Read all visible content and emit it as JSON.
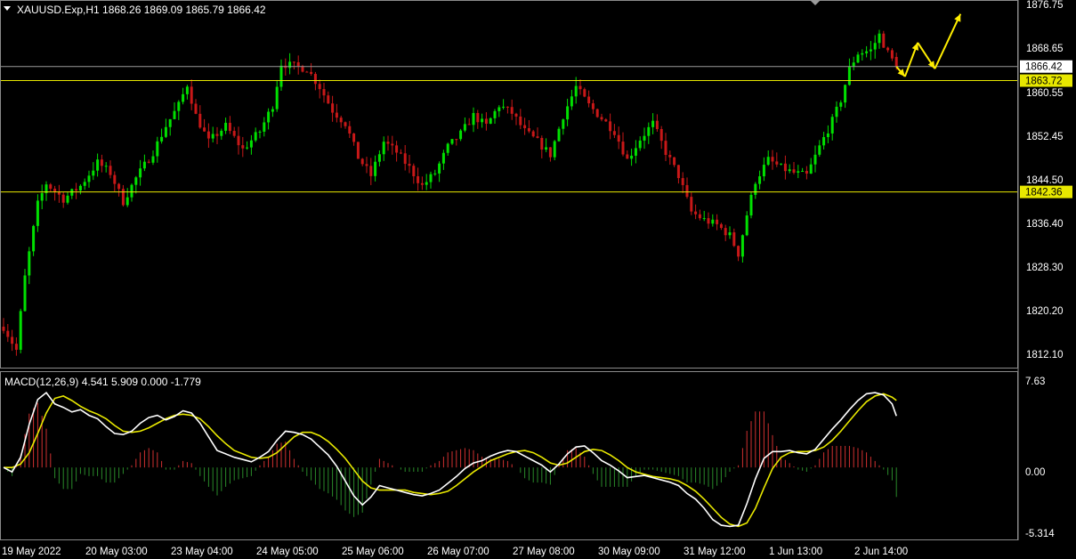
{
  "header": {
    "symbol_line": "XAUUSD.Exp,H1  1868.26 1869.09 1865.79 1866.42"
  },
  "colors": {
    "background": "#000000",
    "bull": "#00e000",
    "bear": "#c81818",
    "level_line": "#e8e800",
    "bid_line": "#9a9a9a",
    "macd_line": "#ffffff",
    "signal_line": "#e8e800",
    "hist_pos": "#d03030",
    "hist_neg": "#2a8a2a",
    "arrow": "#ffee00"
  },
  "price_axis": {
    "ticks": [
      "1876.75",
      "1868.65",
      "1860.55",
      "1852.45",
      "1844.50",
      "1836.40",
      "1828.30",
      "1820.20",
      "1812.10"
    ],
    "current_price": "1866.42",
    "level_upper": "1863.72",
    "level_lower": "1842.36"
  },
  "macd_panel": {
    "title": "MACD(12,26,9) 4.541 5.909 0.000 -1.779",
    "ticks": [
      "7.63",
      "0.00",
      "-5.314"
    ]
  },
  "time_axis": {
    "labels": [
      "19 May 2022",
      "20 May 03:00",
      "23 May 04:00",
      "24 May 05:00",
      "25 May 06:00",
      "26 May 07:00",
      "27 May 08:00",
      "30 May 09:00",
      "31 May 12:00",
      "1 Jun 13:00",
      "2 Jun 14:00"
    ]
  },
  "chart_data": {
    "type": "candlestick",
    "symbol": "XAUUSD.Exp",
    "timeframe": "H1",
    "last_bar": {
      "open": 1868.26,
      "high": 1869.09,
      "low": 1865.79,
      "close": 1866.42
    },
    "ylim": [
      1809.5,
      1878.5
    ],
    "close_path": [
      [
        0,
        1816.5
      ],
      [
        3,
        1812.0
      ],
      [
        5,
        1826.0
      ],
      [
        8,
        1840.0
      ],
      [
        10,
        1844.0
      ],
      [
        14,
        1841.0
      ],
      [
        18,
        1843.5
      ],
      [
        22,
        1848.0
      ],
      [
        25,
        1846.0
      ],
      [
        28,
        1840.5
      ],
      [
        31,
        1845.0
      ],
      [
        35,
        1850.0
      ],
      [
        38,
        1855.0
      ],
      [
        41,
        1859.0
      ],
      [
        43,
        1863.0
      ],
      [
        45,
        1857.0
      ],
      [
        48,
        1852.0
      ],
      [
        52,
        1855.0
      ],
      [
        56,
        1850.5
      ],
      [
        60,
        1854.0
      ],
      [
        63,
        1859.0
      ],
      [
        65,
        1867.0
      ],
      [
        68,
        1866.5
      ],
      [
        71,
        1866.0
      ],
      [
        74,
        1862.5
      ],
      [
        77,
        1858.0
      ],
      [
        80,
        1855.5
      ],
      [
        83,
        1849.0
      ],
      [
        86,
        1845.5
      ],
      [
        89,
        1852.0
      ],
      [
        92,
        1850.0
      ],
      [
        95,
        1847.0
      ],
      [
        98,
        1843.5
      ],
      [
        101,
        1846.0
      ],
      [
        104,
        1851.0
      ],
      [
        107,
        1853.5
      ],
      [
        110,
        1857.0
      ],
      [
        113,
        1855.0
      ],
      [
        116,
        1859.0
      ],
      [
        119,
        1857.5
      ],
      [
        122,
        1854.0
      ],
      [
        125,
        1852.0
      ],
      [
        128,
        1849.5
      ],
      [
        131,
        1857.0
      ],
      [
        134,
        1862.5
      ],
      [
        137,
        1859.0
      ],
      [
        140,
        1856.5
      ],
      [
        143,
        1854.0
      ],
      [
        146,
        1848.5
      ],
      [
        149,
        1852.5
      ],
      [
        152,
        1855.5
      ],
      [
        155,
        1850.0
      ],
      [
        158,
        1845.5
      ],
      [
        161,
        1838.5
      ],
      [
        164,
        1837.0
      ],
      [
        167,
        1836.0
      ],
      [
        170,
        1834.0
      ],
      [
        172,
        1830.5
      ],
      [
        174,
        1838.0
      ],
      [
        176,
        1844.5
      ],
      [
        179,
        1848.5
      ],
      [
        182,
        1847.0
      ],
      [
        185,
        1846.0
      ],
      [
        188,
        1845.5
      ],
      [
        191,
        1851.0
      ],
      [
        194,
        1856.0
      ],
      [
        196,
        1860.0
      ],
      [
        198,
        1866.0
      ],
      [
        200,
        1869.0
      ],
      [
        203,
        1869.5
      ],
      [
        205,
        1872.5
      ],
      [
        207,
        1869.0
      ],
      [
        209,
        1866.4
      ]
    ],
    "macd_ylim": [
      -5.8,
      7.63
    ],
    "macd_line": [
      [
        0,
        0.0
      ],
      [
        2,
        -0.4
      ],
      [
        4,
        0.9
      ],
      [
        6,
        3.8
      ],
      [
        8,
        6.0
      ],
      [
        10,
        6.6
      ],
      [
        12,
        5.6
      ],
      [
        14,
        5.3
      ],
      [
        16,
        4.9
      ],
      [
        18,
        5.1
      ],
      [
        20,
        4.6
      ],
      [
        22,
        4.3
      ],
      [
        24,
        3.6
      ],
      [
        26,
        3.0
      ],
      [
        28,
        2.9
      ],
      [
        30,
        3.2
      ],
      [
        32,
        3.9
      ],
      [
        34,
        4.4
      ],
      [
        36,
        4.6
      ],
      [
        38,
        4.2
      ],
      [
        40,
        4.5
      ],
      [
        42,
        5.0
      ],
      [
        44,
        4.8
      ],
      [
        46,
        3.9
      ],
      [
        48,
        2.7
      ],
      [
        50,
        1.5
      ],
      [
        52,
        1.2
      ],
      [
        54,
        0.9
      ],
      [
        56,
        0.7
      ],
      [
        58,
        0.5
      ],
      [
        60,
        0.9
      ],
      [
        62,
        1.4
      ],
      [
        64,
        2.4
      ],
      [
        66,
        3.2
      ],
      [
        68,
        3.1
      ],
      [
        70,
        2.9
      ],
      [
        72,
        2.5
      ],
      [
        74,
        1.8
      ],
      [
        76,
        1.1
      ],
      [
        78,
        0.1
      ],
      [
        80,
        -1.2
      ],
      [
        82,
        -2.5
      ],
      [
        84,
        -3.3
      ],
      [
        86,
        -2.6
      ],
      [
        88,
        -1.6
      ],
      [
        90,
        -1.8
      ],
      [
        92,
        -2.0
      ],
      [
        94,
        -2.2
      ],
      [
        96,
        -2.4
      ],
      [
        98,
        -2.5
      ],
      [
        100,
        -2.3
      ],
      [
        102,
        -2.0
      ],
      [
        104,
        -1.4
      ],
      [
        106,
        -0.8
      ],
      [
        108,
        -0.1
      ],
      [
        110,
        0.4
      ],
      [
        112,
        0.6
      ],
      [
        114,
        1.0
      ],
      [
        116,
        1.3
      ],
      [
        118,
        1.5
      ],
      [
        120,
        1.4
      ],
      [
        122,
        1.0
      ],
      [
        124,
        0.6
      ],
      [
        126,
        0.2
      ],
      [
        128,
        -0.4
      ],
      [
        130,
        0.3
      ],
      [
        132,
        1.2
      ],
      [
        134,
        1.8
      ],
      [
        136,
        1.9
      ],
      [
        138,
        1.3
      ],
      [
        140,
        0.6
      ],
      [
        142,
        0.2
      ],
      [
        144,
        -0.3
      ],
      [
        146,
        -0.9
      ],
      [
        148,
        -0.8
      ],
      [
        150,
        -0.7
      ],
      [
        152,
        -0.9
      ],
      [
        154,
        -1.1
      ],
      [
        156,
        -1.3
      ],
      [
        158,
        -1.6
      ],
      [
        160,
        -2.3
      ],
      [
        162,
        -2.8
      ],
      [
        164,
        -3.6
      ],
      [
        166,
        -4.6
      ],
      [
        168,
        -5.1
      ],
      [
        170,
        -5.2
      ],
      [
        172,
        -5.1
      ],
      [
        174,
        -3.2
      ],
      [
        176,
        -1.0
      ],
      [
        178,
        0.8
      ],
      [
        180,
        1.4
      ],
      [
        182,
        1.4
      ],
      [
        184,
        1.5
      ],
      [
        186,
        1.3
      ],
      [
        188,
        1.2
      ],
      [
        190,
        1.6
      ],
      [
        192,
        2.5
      ],
      [
        194,
        3.4
      ],
      [
        196,
        4.2
      ],
      [
        198,
        5.1
      ],
      [
        200,
        5.9
      ],
      [
        202,
        6.5
      ],
      [
        204,
        6.6
      ],
      [
        206,
        6.4
      ],
      [
        208,
        5.6
      ],
      [
        209,
        4.54
      ]
    ],
    "signal_line": [
      [
        0,
        0.0
      ],
      [
        2,
        0.0
      ],
      [
        4,
        0.3
      ],
      [
        6,
        1.3
      ],
      [
        8,
        3.0
      ],
      [
        10,
        4.8
      ],
      [
        12,
        6.1
      ],
      [
        14,
        6.3
      ],
      [
        16,
        5.9
      ],
      [
        18,
        5.4
      ],
      [
        20,
        5.0
      ],
      [
        22,
        4.7
      ],
      [
        24,
        4.3
      ],
      [
        26,
        3.7
      ],
      [
        28,
        3.2
      ],
      [
        30,
        3.1
      ],
      [
        32,
        3.2
      ],
      [
        34,
        3.5
      ],
      [
        36,
        3.9
      ],
      [
        38,
        4.3
      ],
      [
        40,
        4.6
      ],
      [
        42,
        4.7
      ],
      [
        44,
        4.6
      ],
      [
        46,
        4.3
      ],
      [
        48,
        3.6
      ],
      [
        50,
        2.8
      ],
      [
        52,
        2.1
      ],
      [
        54,
        1.5
      ],
      [
        56,
        1.2
      ],
      [
        58,
        0.9
      ],
      [
        60,
        0.8
      ],
      [
        62,
        0.9
      ],
      [
        64,
        1.3
      ],
      [
        66,
        2.0
      ],
      [
        68,
        2.7
      ],
      [
        70,
        3.1
      ],
      [
        72,
        3.1
      ],
      [
        74,
        2.8
      ],
      [
        76,
        2.3
      ],
      [
        78,
        1.6
      ],
      [
        80,
        0.8
      ],
      [
        82,
        -0.2
      ],
      [
        84,
        -1.2
      ],
      [
        86,
        -1.8
      ],
      [
        88,
        -2.0
      ],
      [
        90,
        -2.0
      ],
      [
        92,
        -2.0
      ],
      [
        94,
        -2.0
      ],
      [
        96,
        -2.2
      ],
      [
        98,
        -2.3
      ],
      [
        100,
        -2.4
      ],
      [
        102,
        -2.3
      ],
      [
        104,
        -2.1
      ],
      [
        106,
        -1.6
      ],
      [
        108,
        -1.0
      ],
      [
        110,
        -0.4
      ],
      [
        112,
        0.1
      ],
      [
        114,
        0.6
      ],
      [
        116,
        0.9
      ],
      [
        118,
        1.2
      ],
      [
        120,
        1.4
      ],
      [
        122,
        1.5
      ],
      [
        124,
        1.3
      ],
      [
        126,
        0.9
      ],
      [
        128,
        0.4
      ],
      [
        130,
        0.2
      ],
      [
        132,
        0.4
      ],
      [
        134,
        0.9
      ],
      [
        136,
        1.4
      ],
      [
        138,
        1.6
      ],
      [
        140,
        1.5
      ],
      [
        142,
        1.1
      ],
      [
        144,
        0.6
      ],
      [
        146,
        0.0
      ],
      [
        148,
        -0.4
      ],
      [
        150,
        -0.6
      ],
      [
        152,
        -0.8
      ],
      [
        154,
        -0.9
      ],
      [
        156,
        -1.0
      ],
      [
        158,
        -1.2
      ],
      [
        160,
        -1.6
      ],
      [
        162,
        -2.1
      ],
      [
        164,
        -2.8
      ],
      [
        166,
        -3.6
      ],
      [
        168,
        -4.4
      ],
      [
        170,
        -5.0
      ],
      [
        172,
        -5.2
      ],
      [
        174,
        -4.9
      ],
      [
        176,
        -3.6
      ],
      [
        178,
        -1.8
      ],
      [
        180,
        -0.1
      ],
      [
        182,
        0.9
      ],
      [
        184,
        1.3
      ],
      [
        186,
        1.4
      ],
      [
        188,
        1.4
      ],
      [
        190,
        1.5
      ],
      [
        192,
        1.8
      ],
      [
        194,
        2.4
      ],
      [
        196,
        3.2
      ],
      [
        198,
        4.1
      ],
      [
        200,
        5.0
      ],
      [
        202,
        5.8
      ],
      [
        204,
        6.3
      ],
      [
        206,
        6.5
      ],
      [
        208,
        6.2
      ],
      [
        209,
        5.91
      ]
    ],
    "histogram_note": "OsMA = macd_line - signal_line",
    "projection_arrows": [
      [
        209,
        1866.4
      ],
      [
        211,
        1864.5
      ],
      [
        214,
        1871.0
      ],
      [
        218,
        1866.0
      ],
      [
        224,
        1876.5
      ]
    ],
    "bars": 210,
    "legend": "none",
    "grid": false
  }
}
